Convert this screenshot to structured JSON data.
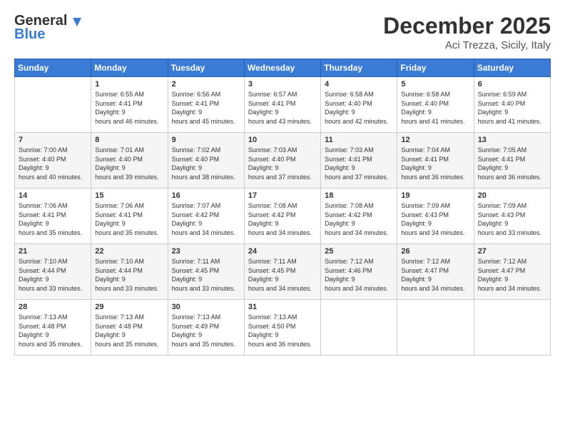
{
  "logo": {
    "general": "General",
    "blue": "Blue"
  },
  "title": "December 2025",
  "location": "Aci Trezza, Sicily, Italy",
  "days_of_week": [
    "Sunday",
    "Monday",
    "Tuesday",
    "Wednesday",
    "Thursday",
    "Friday",
    "Saturday"
  ],
  "weeks": [
    [
      {
        "day": "",
        "sunrise": "",
        "sunset": "",
        "daylight": ""
      },
      {
        "day": "1",
        "sunrise": "6:55 AM",
        "sunset": "4:41 PM",
        "daylight": "9 hours and 46 minutes."
      },
      {
        "day": "2",
        "sunrise": "6:56 AM",
        "sunset": "4:41 PM",
        "daylight": "9 hours and 45 minutes."
      },
      {
        "day": "3",
        "sunrise": "6:57 AM",
        "sunset": "4:41 PM",
        "daylight": "9 hours and 43 minutes."
      },
      {
        "day": "4",
        "sunrise": "6:58 AM",
        "sunset": "4:40 PM",
        "daylight": "9 hours and 42 minutes."
      },
      {
        "day": "5",
        "sunrise": "6:58 AM",
        "sunset": "4:40 PM",
        "daylight": "9 hours and 41 minutes."
      },
      {
        "day": "6",
        "sunrise": "6:59 AM",
        "sunset": "4:40 PM",
        "daylight": "9 hours and 41 minutes."
      }
    ],
    [
      {
        "day": "7",
        "sunrise": "7:00 AM",
        "sunset": "4:40 PM",
        "daylight": "9 hours and 40 minutes."
      },
      {
        "day": "8",
        "sunrise": "7:01 AM",
        "sunset": "4:40 PM",
        "daylight": "9 hours and 39 minutes."
      },
      {
        "day": "9",
        "sunrise": "7:02 AM",
        "sunset": "4:40 PM",
        "daylight": "9 hours and 38 minutes."
      },
      {
        "day": "10",
        "sunrise": "7:03 AM",
        "sunset": "4:40 PM",
        "daylight": "9 hours and 37 minutes."
      },
      {
        "day": "11",
        "sunrise": "7:03 AM",
        "sunset": "4:41 PM",
        "daylight": "9 hours and 37 minutes."
      },
      {
        "day": "12",
        "sunrise": "7:04 AM",
        "sunset": "4:41 PM",
        "daylight": "9 hours and 36 minutes."
      },
      {
        "day": "13",
        "sunrise": "7:05 AM",
        "sunset": "4:41 PM",
        "daylight": "9 hours and 36 minutes."
      }
    ],
    [
      {
        "day": "14",
        "sunrise": "7:06 AM",
        "sunset": "4:41 PM",
        "daylight": "9 hours and 35 minutes."
      },
      {
        "day": "15",
        "sunrise": "7:06 AM",
        "sunset": "4:41 PM",
        "daylight": "9 hours and 35 minutes."
      },
      {
        "day": "16",
        "sunrise": "7:07 AM",
        "sunset": "4:42 PM",
        "daylight": "9 hours and 34 minutes."
      },
      {
        "day": "17",
        "sunrise": "7:08 AM",
        "sunset": "4:42 PM",
        "daylight": "9 hours and 34 minutes."
      },
      {
        "day": "18",
        "sunrise": "7:08 AM",
        "sunset": "4:42 PM",
        "daylight": "9 hours and 34 minutes."
      },
      {
        "day": "19",
        "sunrise": "7:09 AM",
        "sunset": "4:43 PM",
        "daylight": "9 hours and 34 minutes."
      },
      {
        "day": "20",
        "sunrise": "7:09 AM",
        "sunset": "4:43 PM",
        "daylight": "9 hours and 33 minutes."
      }
    ],
    [
      {
        "day": "21",
        "sunrise": "7:10 AM",
        "sunset": "4:44 PM",
        "daylight": "9 hours and 33 minutes."
      },
      {
        "day": "22",
        "sunrise": "7:10 AM",
        "sunset": "4:44 PM",
        "daylight": "9 hours and 33 minutes."
      },
      {
        "day": "23",
        "sunrise": "7:11 AM",
        "sunset": "4:45 PM",
        "daylight": "9 hours and 33 minutes."
      },
      {
        "day": "24",
        "sunrise": "7:11 AM",
        "sunset": "4:45 PM",
        "daylight": "9 hours and 34 minutes."
      },
      {
        "day": "25",
        "sunrise": "7:12 AM",
        "sunset": "4:46 PM",
        "daylight": "9 hours and 34 minutes."
      },
      {
        "day": "26",
        "sunrise": "7:12 AM",
        "sunset": "4:47 PM",
        "daylight": "9 hours and 34 minutes."
      },
      {
        "day": "27",
        "sunrise": "7:12 AM",
        "sunset": "4:47 PM",
        "daylight": "9 hours and 34 minutes."
      }
    ],
    [
      {
        "day": "28",
        "sunrise": "7:13 AM",
        "sunset": "4:48 PM",
        "daylight": "9 hours and 35 minutes."
      },
      {
        "day": "29",
        "sunrise": "7:13 AM",
        "sunset": "4:48 PM",
        "daylight": "9 hours and 35 minutes."
      },
      {
        "day": "30",
        "sunrise": "7:13 AM",
        "sunset": "4:49 PM",
        "daylight": "9 hours and 35 minutes."
      },
      {
        "day": "31",
        "sunrise": "7:13 AM",
        "sunset": "4:50 PM",
        "daylight": "9 hours and 36 minutes."
      },
      {
        "day": "",
        "sunrise": "",
        "sunset": "",
        "daylight": ""
      },
      {
        "day": "",
        "sunrise": "",
        "sunset": "",
        "daylight": ""
      },
      {
        "day": "",
        "sunrise": "",
        "sunset": "",
        "daylight": ""
      }
    ]
  ],
  "labels": {
    "sunrise_prefix": "Sunrise: ",
    "sunset_prefix": "Sunset: ",
    "daylight_prefix": "Daylight: "
  }
}
